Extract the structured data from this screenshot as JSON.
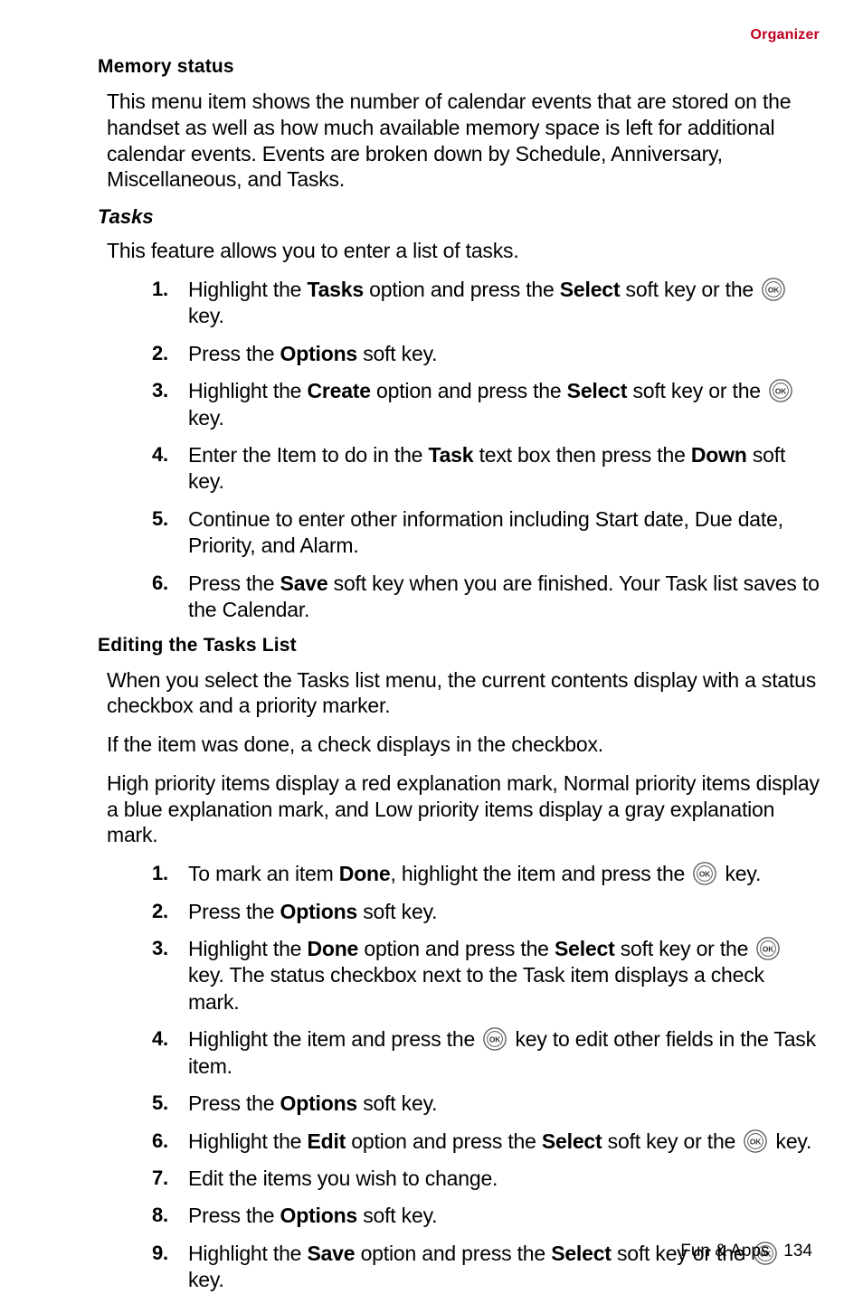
{
  "header": {
    "category": "Organizer"
  },
  "sections": {
    "memory_status": {
      "heading": "Memory status",
      "para": "This menu item shows the number of calendar events that are stored on the handset as well as how much available memory space is left for additional calendar events. Events are broken down by Schedule, Anniversary, Miscellaneous, and Tasks."
    },
    "tasks": {
      "heading": "Tasks",
      "intro": "This feature allows you to enter a list of tasks.",
      "steps": {
        "n1": "1.",
        "s1a": "Highlight the ",
        "s1b": "Tasks",
        "s1c": " option and press the ",
        "s1d": "Select",
        "s1e": " soft key or the ",
        "s1f": " key.",
        "n2": "2.",
        "s2a": "Press the ",
        "s2b": "Options",
        "s2c": " soft key.",
        "n3": "3.",
        "s3a": "Highlight the ",
        "s3b": "Create",
        "s3c": " option and press the ",
        "s3d": "Select",
        "s3e": " soft key or the ",
        "s3f": " key.",
        "n4": "4.",
        "s4a": "Enter the Item to do in the ",
        "s4b": "Task",
        "s4c": " text box then press the ",
        "s4d": "Down",
        "s4e": " soft key.",
        "n5": "5.",
        "s5": "Continue to enter other information including Start date, Due date, Priority, and Alarm.",
        "n6": "6.",
        "s6a": "Press the ",
        "s6b": "Save",
        "s6c": " soft key when you are finished. Your Task list saves to the Calendar."
      }
    },
    "editing": {
      "heading": "Editing the Tasks List",
      "para1": "When you select the Tasks list menu, the current contents display with a status checkbox and a priority marker.",
      "para2": "If the item was done, a check displays in the checkbox.",
      "para3": "High priority items display a red explanation mark, Normal priority items display a blue explanation mark, and Low priority items display a gray explanation mark.",
      "steps": {
        "n1": "1.",
        "s1a": "To mark an item ",
        "s1b": "Done",
        "s1c": ", highlight the item and press the ",
        "s1d": " key.",
        "n2": "2.",
        "s2a": "Press the ",
        "s2b": "Options",
        "s2c": " soft key.",
        "n3": "3.",
        "s3a": "Highlight the ",
        "s3b": "Done",
        "s3c": " option and press the ",
        "s3d": "Select",
        "s3e": " soft key or the ",
        "s3f": " key. The status checkbox next to the Task item displays a check mark.",
        "n4": "4.",
        "s4a": "Highlight the item and press the ",
        "s4b": " key to edit other fields in the Task item.",
        "n5": "5.",
        "s5a": "Press the ",
        "s5b": "Options",
        "s5c": " soft key.",
        "n6": "6.",
        "s6a": "Highlight the ",
        "s6b": "Edit",
        "s6c": " option and press the ",
        "s6d": "Select",
        "s6e": " soft key or the ",
        "s6f": " key.",
        "n7": "7.",
        "s7": "Edit the items you wish to change.",
        "n8": "8.",
        "s8a": "Press the ",
        "s8b": "Options",
        "s8c": " soft key.",
        "n9": "9.",
        "s9a": "Highlight the ",
        "s9b": "Save",
        "s9c": " option and press the ",
        "s9d": "Select",
        "s9e": " soft key or the ",
        "s9f": " key."
      }
    }
  },
  "footer": {
    "chapter": "Fun & Apps",
    "page": "134"
  }
}
